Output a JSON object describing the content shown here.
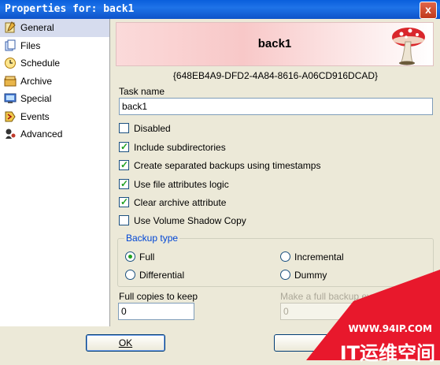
{
  "window": {
    "title": "Properties for: back1",
    "close_glyph": "x"
  },
  "sidebar": {
    "items": [
      {
        "label": "General",
        "icon": "general-icon",
        "active": true
      },
      {
        "label": "Files",
        "icon": "files-icon",
        "active": false
      },
      {
        "label": "Schedule",
        "icon": "schedule-icon",
        "active": false
      },
      {
        "label": "Archive",
        "icon": "archive-icon",
        "active": false
      },
      {
        "label": "Special",
        "icon": "special-icon",
        "active": false
      },
      {
        "label": "Events",
        "icon": "events-icon",
        "active": false
      },
      {
        "label": "Advanced",
        "icon": "advanced-icon",
        "active": false
      }
    ]
  },
  "banner": {
    "title": "back1",
    "icon": "mushroom-icon"
  },
  "task": {
    "guid": "{648EB4A9-DFD2-4A84-8616-A06CD916DCAD}",
    "name_label": "Task name",
    "name_value": "back1"
  },
  "options": [
    {
      "label": "Disabled",
      "checked": false
    },
    {
      "label": "Include subdirectories",
      "checked": true
    },
    {
      "label": "Create separated backups using timestamps",
      "checked": true
    },
    {
      "label": "Use file attributes logic",
      "checked": true
    },
    {
      "label": "Clear archive attribute",
      "checked": true
    },
    {
      "label": "Use Volume Shadow Copy",
      "checked": false
    }
  ],
  "backup_type": {
    "legend": "Backup type",
    "options": [
      {
        "label": "Full",
        "selected": true
      },
      {
        "label": "Incremental",
        "selected": false
      },
      {
        "label": "Differential",
        "selected": false
      },
      {
        "label": "Dummy",
        "selected": false
      }
    ]
  },
  "full_copies": {
    "label": "Full copies to keep",
    "value": "0"
  },
  "full_every": {
    "label": "Make a full backup every",
    "value": "0"
  },
  "buttons": {
    "ok": "OK"
  },
  "watermark": {
    "url": "WWW.94IP.COM",
    "text": "IT运维空间"
  },
  "colors": {
    "accent": "#0046d5",
    "check": "#21a121",
    "title_bar": "#0a5fdc",
    "watermark": "#e8182c"
  }
}
